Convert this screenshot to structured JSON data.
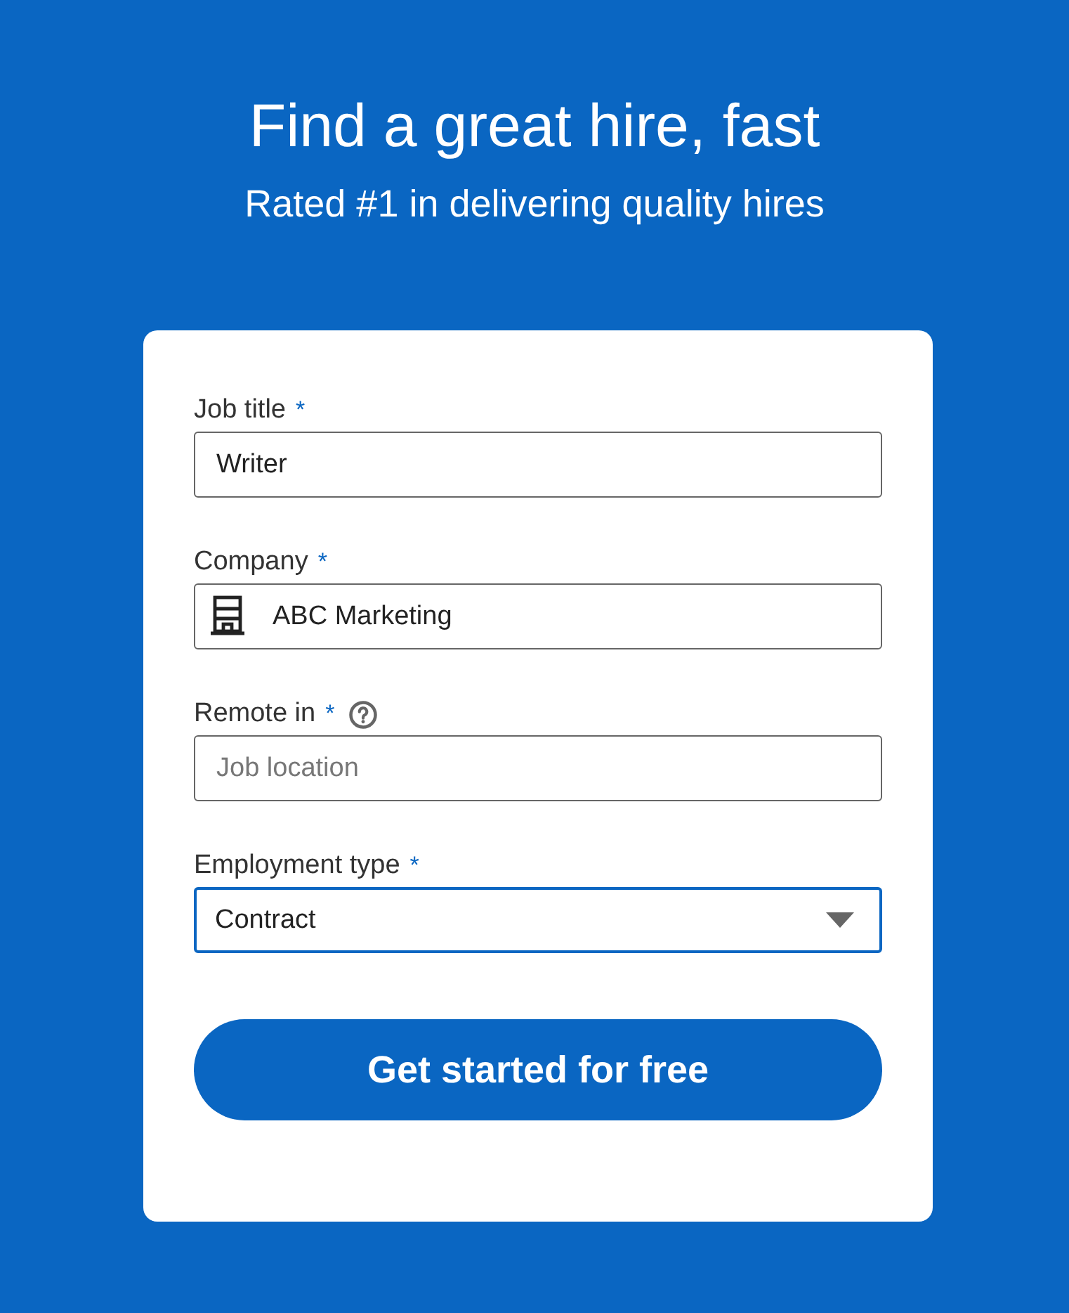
{
  "header": {
    "title": "Find a great hire, fast",
    "subtitle": "Rated #1 in delivering quality hires"
  },
  "fields": [
    {
      "label": "Job title",
      "required_mark": "*",
      "kind": "text",
      "value": "Writer",
      "focused": false
    },
    {
      "label": "Company",
      "required_mark": "*",
      "kind": "text_with_icon",
      "value": "ABC Marketing",
      "focused": false
    },
    {
      "label": "Remote in",
      "required_mark": "*",
      "help": true,
      "kind": "text",
      "placeholder": "Job location",
      "focused": false
    },
    {
      "label": "Employment type",
      "required_mark": "*",
      "kind": "select",
      "value": "Contract",
      "focused": true
    }
  ],
  "submit_button": "Get started for free"
}
